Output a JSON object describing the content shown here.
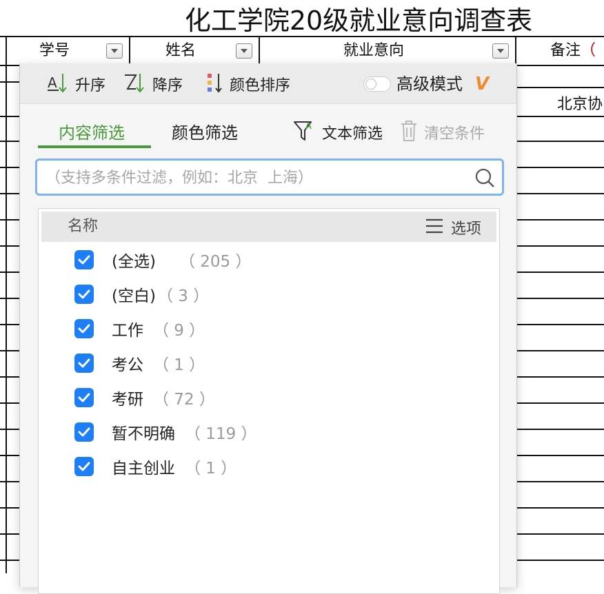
{
  "sheet": {
    "title": "化工学院20级就业意向调查表",
    "headers": [
      {
        "label": "学号"
      },
      {
        "label": "姓名"
      },
      {
        "label": "就业意向"
      },
      {
        "label": "备注",
        "suffix": "（"
      }
    ],
    "visible_cell": "北京协"
  },
  "toolbar": {
    "sort_asc": "升序",
    "sort_desc": "降序",
    "color_sort": "颜色排序",
    "advanced_mode": "高级模式",
    "vip_badge": "V",
    "advanced_mode_on": false
  },
  "tabs": {
    "content_filter": "内容筛选",
    "color_filter": "颜色筛选",
    "text_filter": "文本筛选",
    "clear_conditions": "清空条件"
  },
  "search": {
    "placeholder": "（支持多条件过滤，例如：北京  上海）",
    "value": ""
  },
  "list": {
    "header_name": "名称",
    "options_label": "选项",
    "items": [
      {
        "name": "(全选)",
        "count": "（ 205 ）",
        "checked": true
      },
      {
        "name": "(空白)",
        "count": "（ 3 ）",
        "checked": true
      },
      {
        "name": "工作",
        "count": "（ 9 ）",
        "checked": true
      },
      {
        "name": "考公",
        "count": "（ 1 ）",
        "checked": true
      },
      {
        "name": "考研",
        "count": "（ 72 ）",
        "checked": true
      },
      {
        "name": "暂不明确",
        "count": "（ 119 ）",
        "checked": true
      },
      {
        "name": "自主创业",
        "count": "（ 1 ）",
        "checked": true
      }
    ]
  },
  "colors": {
    "accent_green": "#4a9a3c",
    "checkbox_blue": "#1d7ef5",
    "search_border": "#7fb2f0",
    "vip_orange": "#ef8a2e"
  }
}
